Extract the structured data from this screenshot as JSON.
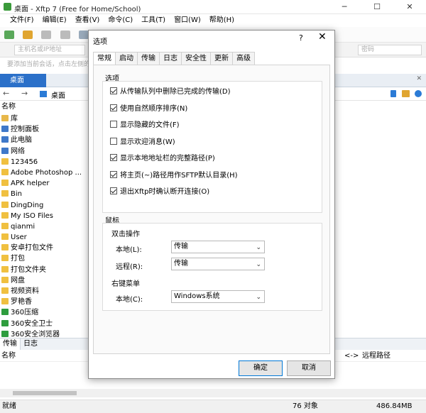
{
  "window": {
    "title": "桌面 - Xftp 7 (Free for Home/School)",
    "min": "─",
    "max": "☐",
    "close": "✕"
  },
  "menu": [
    "文件(F)",
    "编辑(E)",
    "查看(V)",
    "命令(C)",
    "工具(T)",
    "窗口(W)",
    "帮助(H)"
  ],
  "address": {
    "host_placeholder": "主机名或IP地址",
    "pwd_placeholder": "密码",
    "hint": "要添加当前会话，点击左侧的箭头按钮。"
  },
  "tab": {
    "label": "桌面"
  },
  "nav": {
    "path": "桌面"
  },
  "filelist": {
    "header": "名称",
    "items": [
      "库",
      "控制面板",
      "此电脑",
      "网络",
      "123456",
      "Adobe Photoshop ...",
      "APK helper",
      "Bin",
      "DingDing",
      "My ISO Files",
      "qianmi",
      "User",
      "安卓打包文件",
      "打包",
      "打包文件夹",
      "网盘",
      "视频资料",
      "罗艳香",
      "360压缩",
      "360安全卫士",
      "360安全浏览器"
    ]
  },
  "bottom_tabs": [
    "传输",
    "日志"
  ],
  "transfer": {
    "name_col": "名称",
    "arrow_col": "<->",
    "remote_col": "远程路径"
  },
  "status": {
    "left": "就绪",
    "count": "76 对象",
    "size": "486.84MB"
  },
  "dialog": {
    "title": "选项",
    "help": "?",
    "close": "✕",
    "tabs": [
      "常规",
      "启动",
      "传输",
      "日志",
      "安全性",
      "更新",
      "高级"
    ],
    "options_group": "选项",
    "options": [
      {
        "label": "从传输队列中删除已完成的传输(D)",
        "checked": true
      },
      {
        "label": "使用自然顺序排序(N)",
        "checked": true
      },
      {
        "label": "显示隐藏的文件(F)",
        "checked": false
      },
      {
        "label": "显示欢迎消息(W)",
        "checked": false
      },
      {
        "label": "显示本地地址栏的完整路径(P)",
        "checked": true
      },
      {
        "label": "将主页(~)路径用作SFTP默认目录(H)",
        "checked": true
      },
      {
        "label": "退出Xftp时确认断开连接(O)",
        "checked": true
      }
    ],
    "mouse_group": "鼠标",
    "double_click": "双击操作",
    "local_label": "本地(L):",
    "local_value": "传输",
    "remote_label": "远程(R):",
    "remote_value": "传输",
    "right_menu": "右键菜单",
    "local_c_label": "本地(C):",
    "local_c_value": "Windows系统",
    "ok": "确定",
    "cancel": "取消"
  }
}
